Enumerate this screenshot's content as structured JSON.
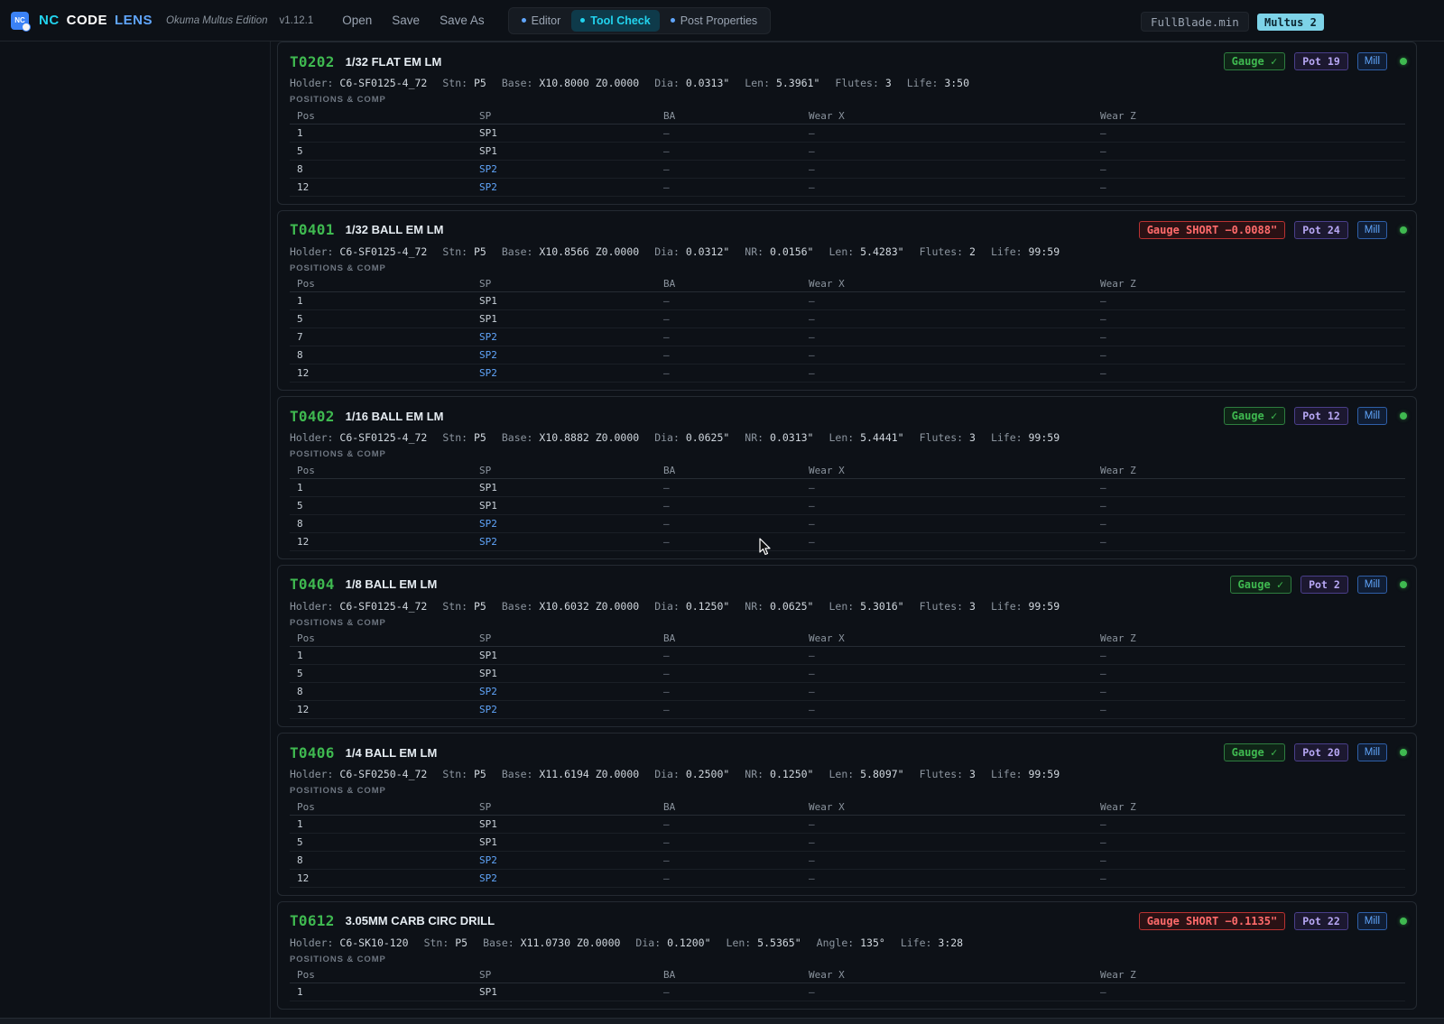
{
  "app": {
    "logo_text": "NC",
    "brand_1": "NC",
    "brand_2": "CODE",
    "brand_3": "LENS",
    "edition": "Okuma Multus Edition",
    "version": "v1.12.1"
  },
  "menu": {
    "open": "Open",
    "save": "Save",
    "save_as": "Save As"
  },
  "tabs": [
    {
      "label": "Editor",
      "active": false
    },
    {
      "label": "Tool Check",
      "active": true
    },
    {
      "label": "Post Properties",
      "active": false
    }
  ],
  "file_name": "FullBlade.min",
  "machine": "Multus 2",
  "labels": {
    "holder": "Holder:",
    "stn": "Stn:",
    "base": "Base:",
    "dia": "Dia:",
    "nr": "NR:",
    "len": "Len:",
    "flutes": "Flutes:",
    "life": "Life:",
    "angle": "Angle:",
    "section": "POSITIONS & COMP",
    "col_pos": "Pos",
    "col_sp": "SP",
    "col_ba": "BA",
    "col_wx": "Wear X",
    "col_wz": "Wear Z",
    "dash": "—"
  },
  "tools": [
    {
      "id": "T0202",
      "name": "1/32 FLAT EM LM",
      "gauge": "Gauge ✓",
      "gauge_ok": true,
      "pot": "Pot 19",
      "type": "Mill",
      "holder": "C6-SF0125-4_72",
      "stn": "P5",
      "base": "X10.8000 Z0.0000",
      "dia": "0.0313\"",
      "len": "5.3961\"",
      "flutes": "3",
      "life": "3:50",
      "rows": [
        {
          "pos": "1",
          "sp": "SP1"
        },
        {
          "pos": "5",
          "sp": "SP1"
        },
        {
          "pos": "8",
          "sp": "SP2"
        },
        {
          "pos": "12",
          "sp": "SP2"
        }
      ]
    },
    {
      "id": "T0401",
      "name": "1/32 BALL EM LM",
      "gauge": "Gauge SHORT −0.0088\"",
      "gauge_ok": false,
      "pot": "Pot 24",
      "type": "Mill",
      "holder": "C6-SF0125-4_72",
      "stn": "P5",
      "base": "X10.8566 Z0.0000",
      "dia": "0.0312\"",
      "nr": "0.0156\"",
      "len": "5.4283\"",
      "flutes": "2",
      "life": "99:59",
      "rows": [
        {
          "pos": "1",
          "sp": "SP1"
        },
        {
          "pos": "5",
          "sp": "SP1"
        },
        {
          "pos": "7",
          "sp": "SP2"
        },
        {
          "pos": "8",
          "sp": "SP2"
        },
        {
          "pos": "12",
          "sp": "SP2"
        }
      ]
    },
    {
      "id": "T0402",
      "name": "1/16 BALL EM LM",
      "gauge": "Gauge ✓",
      "gauge_ok": true,
      "pot": "Pot 12",
      "type": "Mill",
      "holder": "C6-SF0125-4_72",
      "stn": "P5",
      "base": "X10.8882 Z0.0000",
      "dia": "0.0625\"",
      "nr": "0.0313\"",
      "len": "5.4441\"",
      "flutes": "3",
      "life": "99:59",
      "rows": [
        {
          "pos": "1",
          "sp": "SP1"
        },
        {
          "pos": "5",
          "sp": "SP1"
        },
        {
          "pos": "8",
          "sp": "SP2"
        },
        {
          "pos": "12",
          "sp": "SP2"
        }
      ]
    },
    {
      "id": "T0404",
      "name": "1/8 BALL EM LM",
      "gauge": "Gauge ✓",
      "gauge_ok": true,
      "pot": "Pot 2",
      "type": "Mill",
      "holder": "C6-SF0125-4_72",
      "stn": "P5",
      "base": "X10.6032 Z0.0000",
      "dia": "0.1250\"",
      "nr": "0.0625\"",
      "len": "5.3016\"",
      "flutes": "3",
      "life": "99:59",
      "rows": [
        {
          "pos": "1",
          "sp": "SP1"
        },
        {
          "pos": "5",
          "sp": "SP1"
        },
        {
          "pos": "8",
          "sp": "SP2"
        },
        {
          "pos": "12",
          "sp": "SP2"
        }
      ]
    },
    {
      "id": "T0406",
      "name": "1/4 BALL EM LM",
      "gauge": "Gauge ✓",
      "gauge_ok": true,
      "pot": "Pot 20",
      "type": "Mill",
      "holder": "C6-SF0250-4_72",
      "stn": "P5",
      "base": "X11.6194 Z0.0000",
      "dia": "0.2500\"",
      "nr": "0.1250\"",
      "len": "5.8097\"",
      "flutes": "3",
      "life": "99:59",
      "rows": [
        {
          "pos": "1",
          "sp": "SP1"
        },
        {
          "pos": "5",
          "sp": "SP1"
        },
        {
          "pos": "8",
          "sp": "SP2"
        },
        {
          "pos": "12",
          "sp": "SP2"
        }
      ]
    },
    {
      "id": "T0612",
      "name": "3.05MM CARB CIRC DRILL",
      "gauge": "Gauge SHORT −0.1135\"",
      "gauge_ok": false,
      "pot": "Pot 22",
      "type": "Mill",
      "holder": "C6-SK10-120",
      "stn": "P5",
      "base": "X11.0730 Z0.0000",
      "dia": "0.1200\"",
      "len": "5.5365\"",
      "angle": "135°",
      "life": "3:28",
      "rows": [
        {
          "pos": "1",
          "sp": "SP1"
        }
      ]
    }
  ],
  "colors": {
    "accent_cyan": "#22d3ee",
    "tool_green": "#3fb950",
    "error_red": "#ff6b6b",
    "sp2_blue": "#60a5fa"
  }
}
